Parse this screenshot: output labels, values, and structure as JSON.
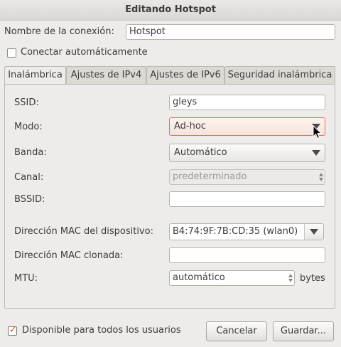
{
  "window": {
    "title": "Editando Hotspot"
  },
  "connection": {
    "name_label": "Nombre de la conexión:",
    "name_value": "Hotspot"
  },
  "autoconnect": {
    "label": "Conectar automáticamente",
    "checked": false
  },
  "tabs": [
    {
      "label": "Inalámbrica",
      "active": true
    },
    {
      "label": "Ajustes de IPv4",
      "active": false
    },
    {
      "label": "Ajustes de IPv6",
      "active": false
    },
    {
      "label": "Seguridad inalámbrica",
      "active": false
    }
  ],
  "wireless": {
    "ssid_label": "SSID:",
    "ssid_value": "gleys",
    "mode_label": "Modo:",
    "mode_value": "Ad-hoc",
    "band_label": "Banda:",
    "band_value": "Automático",
    "channel_label": "Canal:",
    "channel_value": "predeterminado",
    "bssid_label": "BSSID:",
    "bssid_value": "",
    "mac_label": "Dirección MAC del dispositivo:",
    "mac_value": "B4:74:9F:7B:CD:35 (wlan0)",
    "cloned_mac_label": "Dirección MAC clonada:",
    "cloned_mac_value": "",
    "mtu_label": "MTU:",
    "mtu_value": "automático",
    "mtu_unit": "bytes"
  },
  "footer": {
    "all_users_label": "Disponible para todos los usuarios",
    "all_users_checked": true,
    "cancel_label": "Cancelar",
    "save_label": "Guardar..."
  },
  "colors": {
    "accent": "#e05a28",
    "window_bg": "#edeceb"
  }
}
